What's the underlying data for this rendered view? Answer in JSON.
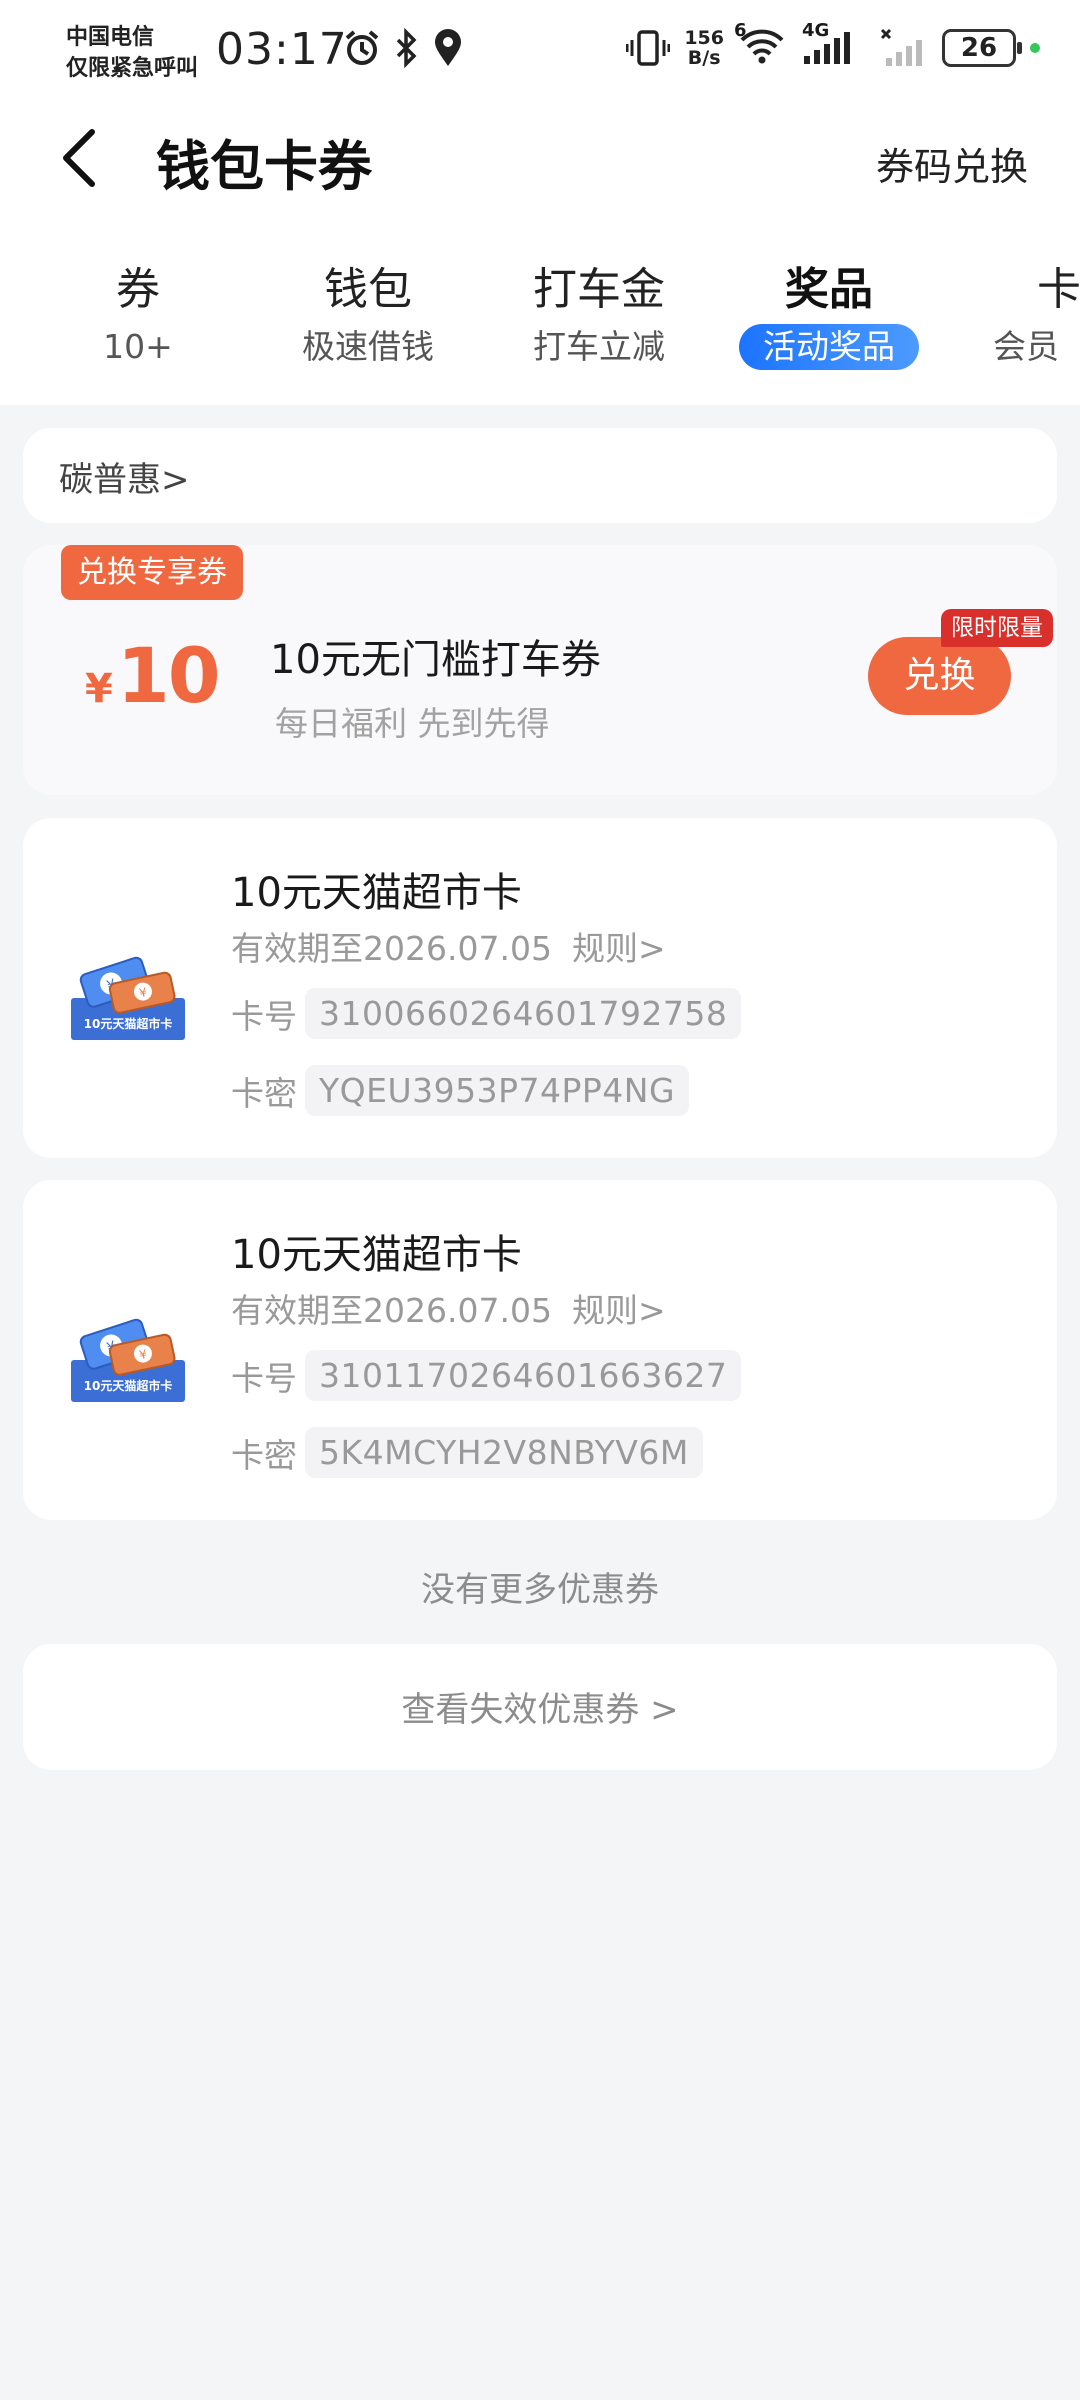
{
  "status_bar": {
    "carrier_line1": "中国电信",
    "carrier_line2": "仅限紧急呼叫",
    "time": "03:17",
    "net_speed_value": "156",
    "net_speed_unit": "B/s",
    "wifi_badge": "6",
    "cellular_label": "4G",
    "battery": "26"
  },
  "header": {
    "title": "钱包卡券",
    "redeem_code": "券码兑换"
  },
  "tabs": [
    {
      "label": "券",
      "sub": "10+"
    },
    {
      "label": "钱包",
      "sub": "极速借钱"
    },
    {
      "label": "打车金",
      "sub": "打车立减"
    },
    {
      "label": "奖品",
      "sub": "活动奖品",
      "active": true
    },
    {
      "label": "卡",
      "sub": "会员"
    }
  ],
  "brand": {
    "label": "碳普惠>"
  },
  "offer": {
    "badge": "兑换专享券",
    "currency": "¥",
    "amount": "10",
    "title": "10元无门槛打车券",
    "subtitle": "每日福利 先到先得",
    "button": "兑换",
    "limit_tag": "限时限量"
  },
  "coupons": [
    {
      "title": "10元天猫超市卡",
      "valid": "有效期至2026.07.05",
      "rules": "规则>",
      "card_no_label": "卡号",
      "card_no": "3100660264601792758",
      "card_pw_label": "卡密",
      "card_pw": "YQEU3953P74PP4NG",
      "icon_text": "10元天猫超市卡"
    },
    {
      "title": "10元天猫超市卡",
      "valid": "有效期至2026.07.05",
      "rules": "规则>",
      "card_no_label": "卡号",
      "card_no": "3101170264601663627",
      "card_pw_label": "卡密",
      "card_pw": "5K4MCYH2V8NBYV6M",
      "icon_text": "10元天猫超市卡"
    }
  ],
  "footer": {
    "no_more": "没有更多优惠券",
    "expired_link": "查看失效优惠券 >"
  },
  "colors": {
    "accent_orange": "#f0683f",
    "tab_active_blue": "#1c74ff",
    "limit_red": "#d9302c"
  }
}
